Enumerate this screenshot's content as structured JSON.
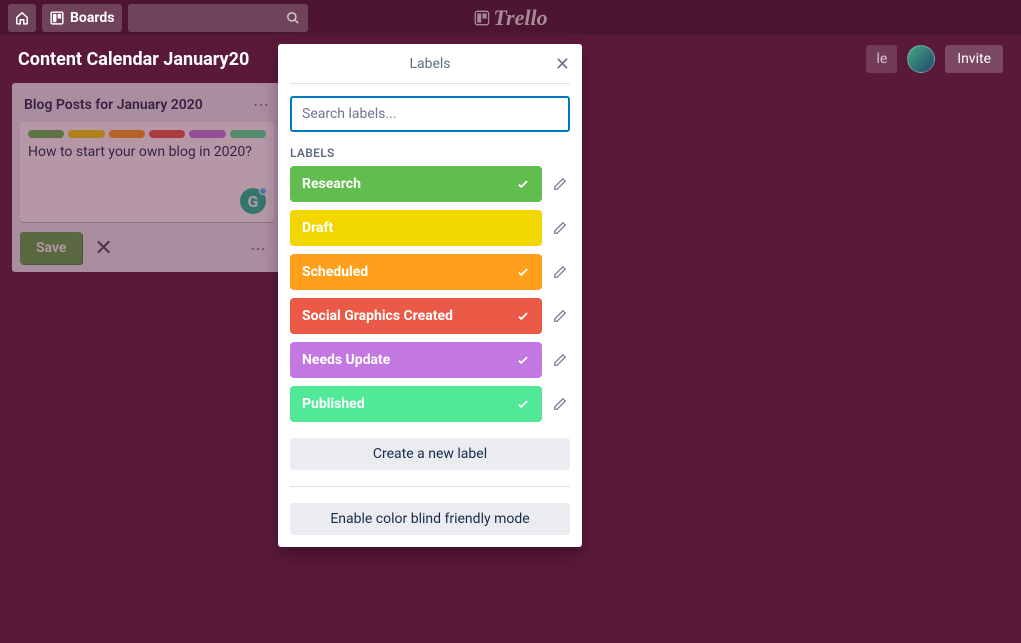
{
  "topbar": {
    "boards_label": "Boards",
    "logo": "Trello"
  },
  "board": {
    "title": "Content Calendar January20",
    "team_label": "le",
    "invite_label": "Invite"
  },
  "list": {
    "title": "Blog Posts for January 2020",
    "card_text": "How to start your own blog in 2020?",
    "save_label": "Save",
    "card_label_colors": [
      "#61bd4f",
      "#f2d600",
      "#ff9f1a",
      "#eb5a46",
      "#c377e0",
      "#51e898"
    ]
  },
  "popover": {
    "title": "Labels",
    "search_placeholder": "Search labels...",
    "section_label": "LABELS",
    "create_label": "Create a new label",
    "colorblind_label": "Enable color blind friendly mode",
    "labels": [
      {
        "name": "Research",
        "color": "#61bd4f",
        "checked": true
      },
      {
        "name": "Draft",
        "color": "#f2d600",
        "checked": false
      },
      {
        "name": "Scheduled",
        "color": "#ff9f1a",
        "checked": true
      },
      {
        "name": "Social Graphics Created",
        "color": "#eb5a46",
        "checked": true
      },
      {
        "name": "Needs Update",
        "color": "#c377e0",
        "checked": true
      },
      {
        "name": "Published",
        "color": "#51e898",
        "checked": true
      }
    ]
  }
}
